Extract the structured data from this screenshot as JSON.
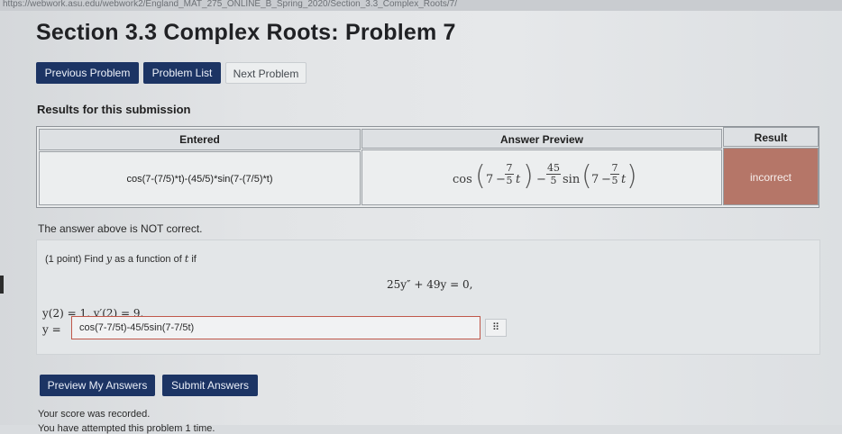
{
  "browser": {
    "url": "https://webwork.asu.edu/webwork2/England_MAT_275_ONLINE_B_Spring_2020/Section_3.3_Complex_Roots/7/"
  },
  "page": {
    "title": "Section 3.3 Complex Roots: Problem 7"
  },
  "nav": {
    "previous": "Previous Problem",
    "list": "Problem List",
    "next": "Next Problem"
  },
  "results": {
    "heading": "Results for this submission",
    "columns": {
      "entered": "Entered",
      "preview": "Answer Preview",
      "result": "Result"
    },
    "row": {
      "entered": "cos(7-(7/5)*t)-(45/5)*sin(7-(7/5)*t)",
      "result": "incorrect",
      "preview": {
        "cos": "cos",
        "sin": "sin",
        "seven_a": "7",
        "seven_b": "7",
        "minus_a": "−",
        "minus_b": "−",
        "minus_c": "−",
        "frac1_num": "7",
        "frac1_den": "5",
        "t1": "t",
        "frac2_num": "45",
        "frac2_den": "5",
        "frac3_num": "7",
        "frac3_den": "5",
        "t2": "t"
      }
    }
  },
  "feedback": {
    "status": "The answer above is NOT correct."
  },
  "problem": {
    "statement_prefix": "(1 point) Find",
    "var_y": "y",
    "statement_mid": "as a function of",
    "var_t": "t",
    "statement_suffix": "if",
    "equation": "25y″ + 49y = 0,",
    "initial_conditions": "y(2) = 1,   y′(2) = 9.",
    "answer_label": "y =",
    "answer_value": "cos(7-7/5t)-45/5sin(7-7/5t)",
    "grid_icon_glyph": "⠿"
  },
  "actions": {
    "preview": "Preview My Answers",
    "submit": "Submit Answers"
  },
  "status": {
    "recorded": "Your score was recorded.",
    "attempts": "You have attempted this problem 1 time."
  },
  "colors": {
    "nav_button": "#1c3464",
    "incorrect_cell": "#b57668"
  }
}
